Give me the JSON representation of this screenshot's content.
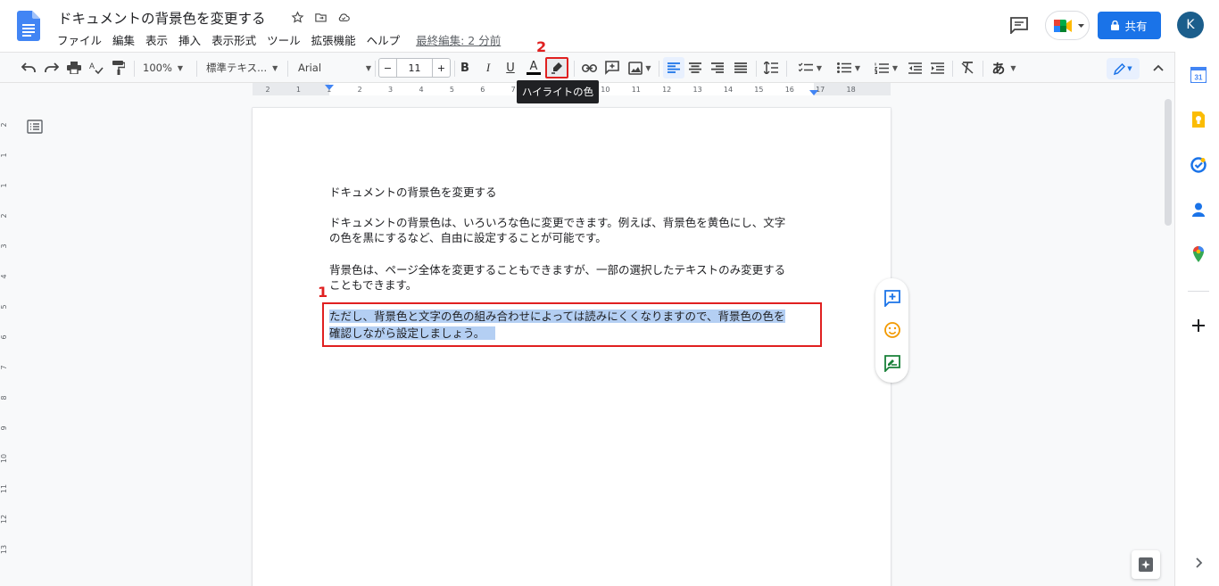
{
  "header": {
    "doc_title": "ドキュメントの背景色を変更する",
    "menu": [
      "ファイル",
      "編集",
      "表示",
      "挿入",
      "表示形式",
      "ツール",
      "拡張機能",
      "ヘルプ"
    ],
    "last_edit": "最終編集: 2 分前",
    "share_label": "共有",
    "avatar_initial": "K"
  },
  "toolbar": {
    "zoom": "100%",
    "style": "標準テキス...",
    "font": "Arial",
    "font_size": "11",
    "minus": "−",
    "plus": "+",
    "bold": "B",
    "italic": "I",
    "underline": "U",
    "text_color": "A",
    "input_tools": "あ",
    "tooltip": "ハイライトの色"
  },
  "annotations": {
    "label_1": "1",
    "label_2": "2"
  },
  "document": {
    "title_line": "ドキュメントの背景色を変更する",
    "para1_line1": "ドキュメントの背景色は、いろいろな色に変更できます。例えば、背景色を黄色にし、文字",
    "para1_line2": "の色を黒にするなど、自由に設定することが可能です。",
    "para2_line1": "背景色は、ページ全体を変更することもできますが、一部の選択したテキストのみ変更する",
    "para2_line2": "こともできます。",
    "para3_line1": "ただし、背景色と文字の色の組み合わせによっては読みにくくなりますので、背景色の色を",
    "para3_line2": "確認しながら設定しましょう。"
  },
  "ruler": {
    "h_labels": [
      "2",
      "1",
      "1",
      "2",
      "3",
      "4",
      "5",
      "6",
      "7",
      "8",
      "9",
      "10",
      "11",
      "12",
      "13",
      "14",
      "15",
      "16",
      "17",
      "18"
    ],
    "v_labels": [
      "2",
      "1",
      "1",
      "2",
      "3",
      "4",
      "5",
      "6",
      "7",
      "8",
      "9",
      "10",
      "11",
      "12",
      "13"
    ]
  },
  "colors": {
    "accent": "#1a73e8",
    "highlight": "#b4cff3",
    "annotation": "#e02020"
  }
}
